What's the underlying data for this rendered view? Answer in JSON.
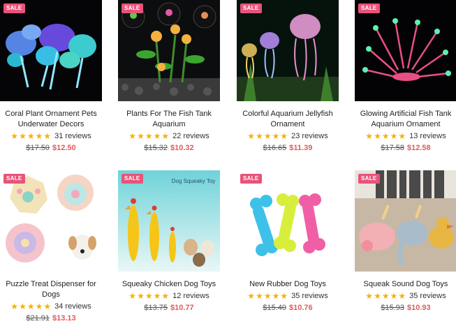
{
  "sale_label": "SALE",
  "colors": {
    "sale_badge": "#e8537a",
    "star": "#f4b400",
    "sale_price": "#e25a5a"
  },
  "products": [
    {
      "title_lines": [
        "Coral Plant Ornament Pets",
        "Underwater Decors"
      ],
      "reviews": "31 reviews",
      "old_price": "$17.50",
      "price": "$12.50",
      "rating": 5
    },
    {
      "title_lines": [
        "Plants For The Fish Tank",
        "Aquarium"
      ],
      "reviews": "22 reviews",
      "old_price": "$15.32",
      "price": "$10.32",
      "rating": 5
    },
    {
      "title_lines": [
        "Colorful Aquarium Jellyfish",
        "Ornament"
      ],
      "reviews": "23 reviews",
      "old_price": "$16.65",
      "price": "$11.39",
      "rating": 5
    },
    {
      "title_lines": [
        "Glowing Artificial Fish Tank",
        "Aquarium Ornament"
      ],
      "reviews": "13 reviews",
      "old_price": "$17.58",
      "price": "$12.58",
      "rating": 5
    },
    {
      "title_lines": [
        "Puzzle Treat Dispenser for",
        "Dogs"
      ],
      "reviews": "34 reviews",
      "old_price": "$21.91",
      "price": "$13.13",
      "rating": 5
    },
    {
      "title_lines": [
        "Squeaky Chicken Dog Toys"
      ],
      "reviews": "12 reviews",
      "old_price": "$13.75",
      "price": "$10.77",
      "rating": 5
    },
    {
      "title_lines": [
        "New Rubber Dog Toys"
      ],
      "reviews": "35 reviews",
      "old_price": "$15.40",
      "price": "$10.76",
      "rating": 5
    },
    {
      "title_lines": [
        "Squeak Sound Dog Toys"
      ],
      "reviews": "35 reviews",
      "old_price": "$15.93",
      "price": "$10.93",
      "rating": 5
    }
  ],
  "image_text": {
    "squeaky_toy_banner": "Dog Squeaky Toy"
  }
}
